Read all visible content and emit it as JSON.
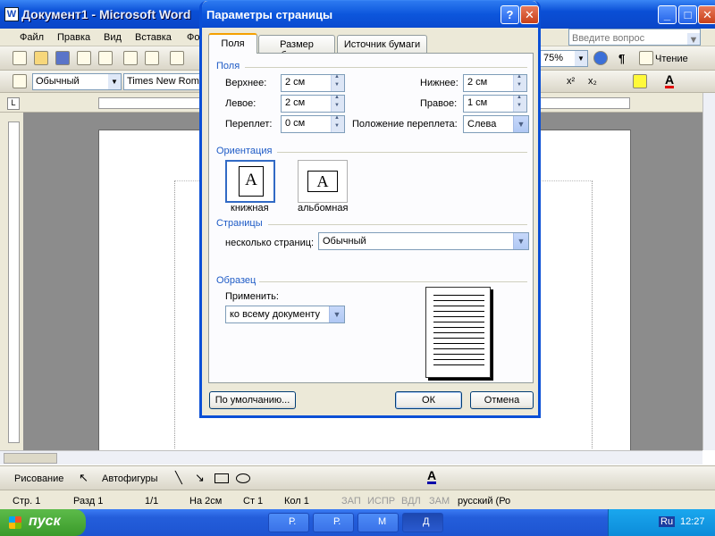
{
  "word": {
    "title": "Документ1 - Microsoft Word",
    "menu": [
      "Файл",
      "Правка",
      "Вид",
      "Вставка",
      "Фо"
    ],
    "help_placeholder": "Введите вопрос",
    "zoom": "75%",
    "reading": "Чтение",
    "style": "Обычный",
    "font": "Times New Roman",
    "draw_label": "Рисование",
    "autoshapes_label": "Автофигуры",
    "status": {
      "page": "Стр. 1",
      "section": "Разд 1",
      "pages": "1/1",
      "at": "На  2см",
      "line": "Ст  1",
      "col": "Кол  1",
      "rec": "ЗАП",
      "trk": "ИСПР",
      "ext": "ВДЛ",
      "ovr": "ЗАМ",
      "lang": "русский (Ро"
    }
  },
  "taskbar": {
    "start": "пуск",
    "tasks": [
      "Р.",
      "Р.",
      "М",
      "Д"
    ],
    "lang": "Ru",
    "time": "12:27"
  },
  "dialog": {
    "title": "Параметры страницы",
    "tabs": [
      "Поля",
      "Размер бумаги",
      "Источник бумаги"
    ],
    "margins": {
      "section": "Поля",
      "top_label": "Верхнее:",
      "top_value": "2 см",
      "bottom_label": "Нижнее:",
      "bottom_value": "2 см",
      "left_label": "Левое:",
      "left_value": "2 см",
      "right_label": "Правое:",
      "right_value": "1 см",
      "gutter_label": "Переплет:",
      "gutter_value": "0 см",
      "gutter_pos_label": "Положение переплета:",
      "gutter_pos_value": "Слева"
    },
    "orientation": {
      "section": "Ориентация",
      "portrait": "книжная",
      "landscape": "альбомная",
      "glyph": "A"
    },
    "pages": {
      "section": "Страницы",
      "multiple_label": "несколько страниц:",
      "multiple_value": "Обычный"
    },
    "preview": {
      "section": "Образец",
      "apply_label": "Применить:",
      "apply_value": "ко всему документу"
    },
    "buttons": {
      "default": "По умолчанию...",
      "ok": "ОК",
      "cancel": "Отмена"
    }
  }
}
